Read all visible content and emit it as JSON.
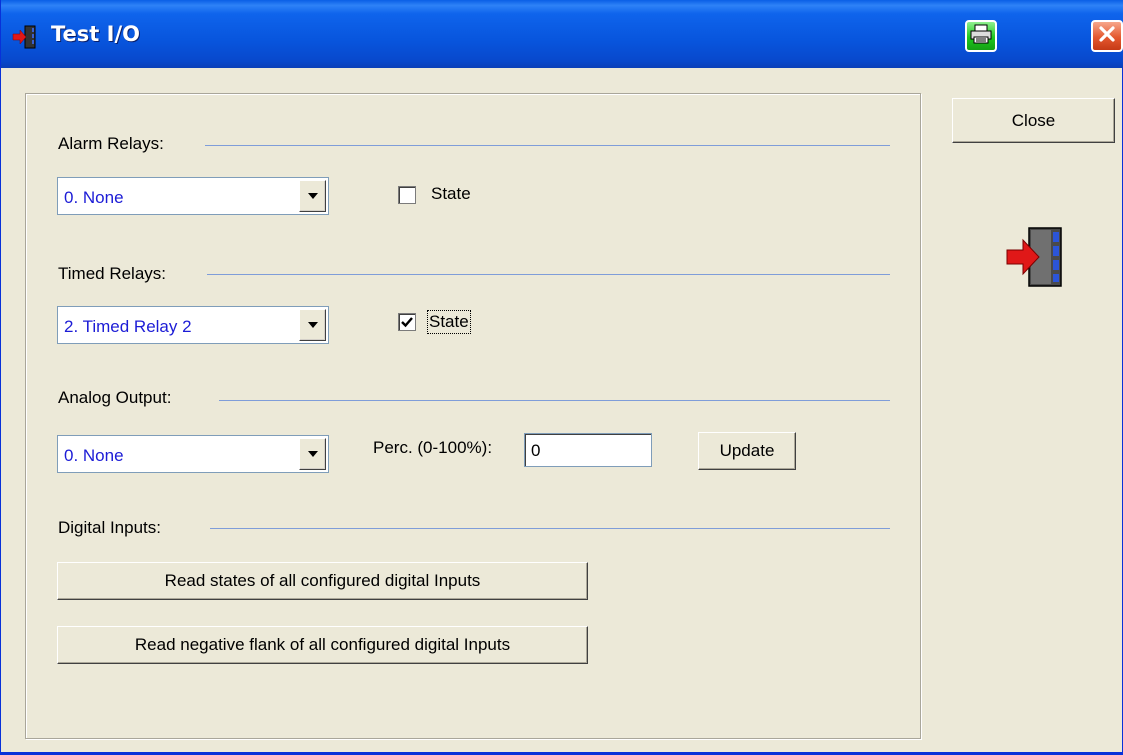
{
  "window": {
    "title": "Test I/O"
  },
  "titlebar": {
    "print_icon": "printer-icon",
    "close_icon": "close-x-icon"
  },
  "sections": {
    "alarm": {
      "label": "Alarm Relays:",
      "selected": "0. None",
      "state_label": "State",
      "state_checked": false
    },
    "timed": {
      "label": "Timed Relays:",
      "selected": "2. Timed Relay 2",
      "state_label": "State",
      "state_checked": true
    },
    "analog": {
      "label": "Analog Output:",
      "selected": "0. None",
      "perc_label": "Perc. (0-100%):",
      "perc_value": "0",
      "update_label": "Update"
    },
    "digital": {
      "label": "Digital Inputs:",
      "read_states_label": "Read states of all configured digital Inputs",
      "read_flank_label": "Read negative flank of all configured digital Inputs"
    }
  },
  "sidebar": {
    "close_label": "Close",
    "icon": "exit-door-icon"
  },
  "colors": {
    "titlebar": "#0855dd",
    "face": "#ece9d8",
    "combo_text": "#1c1cd6",
    "section_line": "#7f9dd9"
  }
}
